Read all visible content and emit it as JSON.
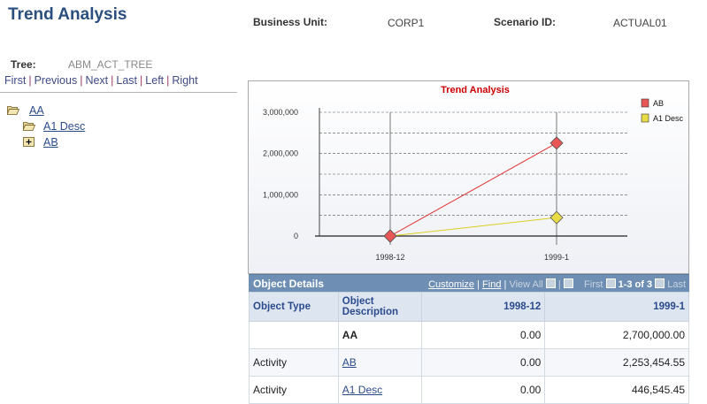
{
  "header": {
    "title": "Trend Analysis",
    "business_unit_label": "Business Unit:",
    "business_unit_value": "CORP1",
    "scenario_label": "Scenario ID:",
    "scenario_value": "ACTUAL01"
  },
  "tree": {
    "label": "Tree:",
    "value": "ABM_ACT_TREE",
    "nav": [
      "First",
      "Previous",
      "Next",
      "Last",
      "Left",
      "Right"
    ],
    "nodes": [
      {
        "label": "AA",
        "icon": "folder-open-icon"
      },
      {
        "label": "A1 Desc",
        "icon": "folder-open-icon"
      },
      {
        "label": "AB",
        "icon": "expand-plus-icon"
      }
    ]
  },
  "chart_data": {
    "type": "line",
    "title": "Trend Analysis",
    "categories": [
      "1998-12",
      "1999-1"
    ],
    "y_ticks": [
      "3,000,000",
      "2,000,000",
      "1,000,000",
      "0"
    ],
    "ylim": [
      0,
      3000000
    ],
    "series": [
      {
        "name": "AB",
        "values": [
          0,
          2253454.55
        ],
        "color": "#e85656",
        "line_color": "#e03030"
      },
      {
        "name": "A1 Desc",
        "values": [
          0,
          446545.45
        ],
        "color": "#e8dc46",
        "line_color": "#d8d020"
      }
    ],
    "legend_position": "top-right",
    "grid": true,
    "title_color": "#cc0000"
  },
  "grid": {
    "title": "Object Details",
    "customize": "Customize",
    "find": "Find",
    "view_all": "View All",
    "first": "First",
    "range": "1-3 of 3",
    "last": "Last",
    "columns": [
      "Object Type",
      "Object Description",
      "1998-12",
      "1999-1"
    ],
    "rows": [
      {
        "type": "",
        "desc": "AA",
        "v1": "0.00",
        "v2": "2,700,000.00"
      },
      {
        "type": "Activity",
        "desc": "AB",
        "v1": "0.00",
        "v2": "2,253,454.55"
      },
      {
        "type": "Activity",
        "desc": "A1 Desc",
        "v1": "0.00",
        "v2": "446,545.45"
      }
    ]
  }
}
